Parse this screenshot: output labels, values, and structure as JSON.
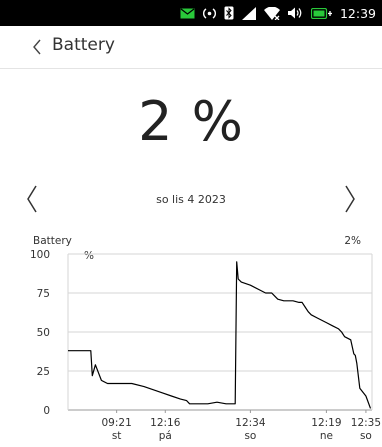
{
  "status_bar": {
    "time": "12:39",
    "icons": [
      "message-icon",
      "nfc-icon",
      "bluetooth-icon",
      "signal-icon",
      "wifi-icon",
      "volume-icon",
      "battery-charging-icon"
    ],
    "accent_color": "#29c93a"
  },
  "header": {
    "title": "Battery"
  },
  "battery": {
    "level_text": "2 %",
    "level": 2
  },
  "navigation": {
    "date": "so lis 4 2023"
  },
  "chart_data": {
    "type": "line",
    "title": "Battery",
    "ylabel": "%",
    "current_label": "2%",
    "ylim": [
      0,
      100
    ],
    "yticks": [
      0,
      25,
      50,
      75,
      100
    ],
    "xlim": [
      0,
      100
    ],
    "grid": true,
    "x_ticks": [
      {
        "x": 16,
        "time": "09:21",
        "day": "st"
      },
      {
        "x": 32,
        "time": "12:16",
        "day": "pá"
      },
      {
        "x": 60,
        "time": "12:34",
        "day": "so"
      },
      {
        "x": 85,
        "time": "12:19",
        "day": "ne"
      },
      {
        "x": 98,
        "time": "12:35",
        "day": "so"
      }
    ],
    "series": [
      {
        "color": "#000000",
        "x": [
          0,
          7,
          7.5,
          8,
          9,
          11,
          13,
          17,
          21,
          25,
          28,
          31,
          34,
          37,
          39,
          40,
          43,
          46,
          49,
          52,
          55,
          55.5,
          56,
          57,
          60,
          63,
          65,
          67,
          68,
          69,
          71,
          74,
          76,
          77,
          78,
          79,
          80,
          82,
          85,
          87,
          89,
          90,
          91,
          93,
          94,
          94.5,
          95,
          96,
          98,
          99.5
        ],
        "y": [
          38,
          38,
          38,
          22,
          29,
          19,
          17,
          17,
          17,
          15,
          13,
          11,
          9,
          7,
          6,
          4,
          4,
          4,
          5,
          4,
          4,
          95,
          84,
          82,
          80,
          77,
          75,
          75,
          73,
          71,
          70,
          70,
          69,
          69,
          66,
          63,
          61,
          59,
          56,
          54,
          52,
          50,
          47,
          45,
          36,
          35,
          30,
          14,
          9,
          1
        ]
      }
    ]
  }
}
